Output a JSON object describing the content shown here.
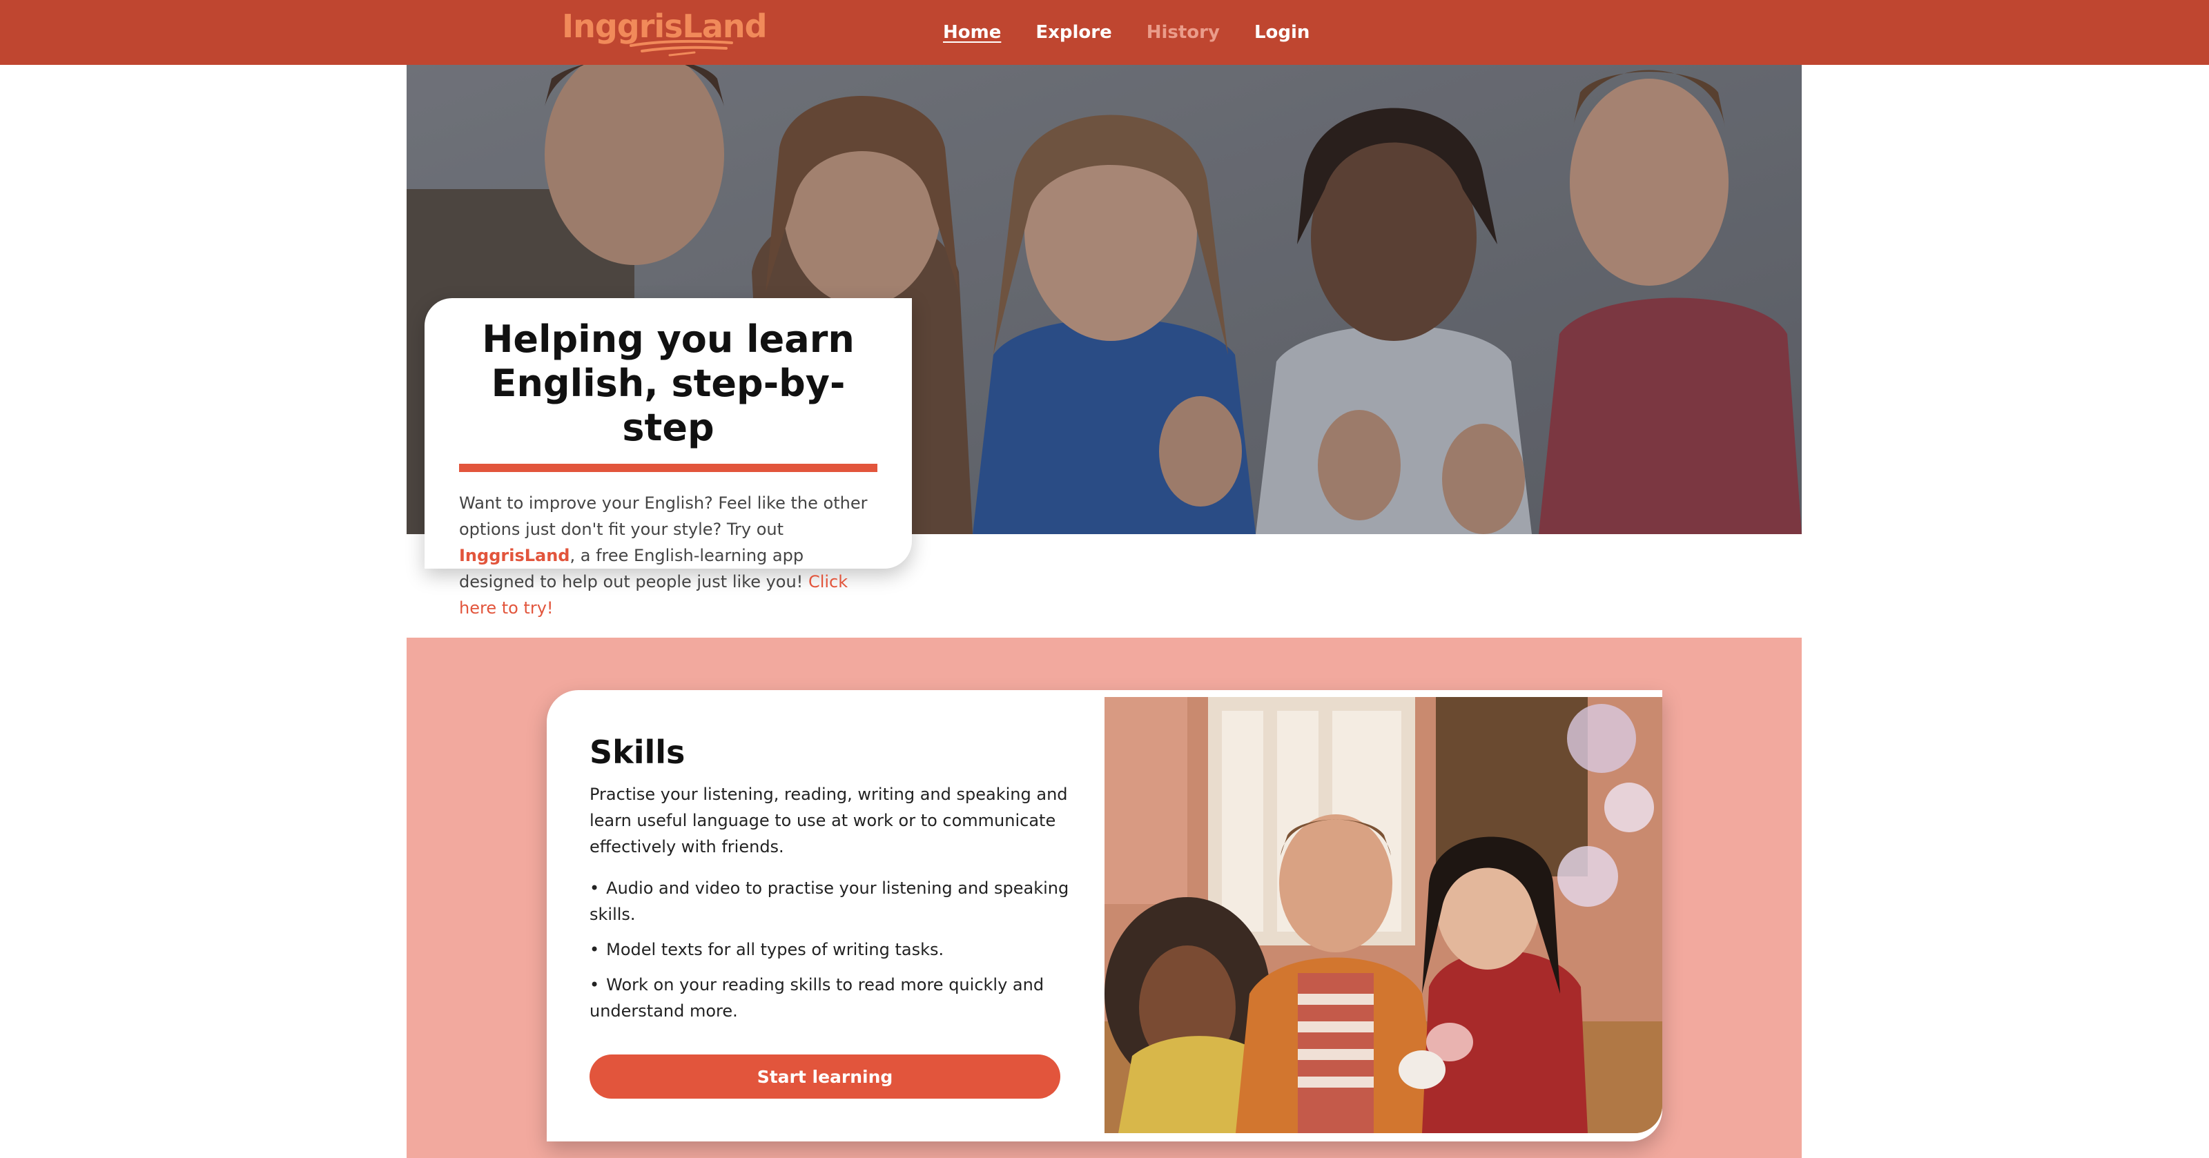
{
  "header": {
    "logo_text": "InggrisLand",
    "nav": [
      {
        "label": "Home"
      },
      {
        "label": "Explore"
      },
      {
        "label": "History"
      },
      {
        "label": "Login"
      }
    ]
  },
  "hero": {
    "title": "Helping you learn English, step-by-step",
    "text_before": "Want to improve your English? Feel like the other options just don't fit your style? Try out ",
    "brand": "InggrisLand",
    "text_after": ", a free English-learning app designed to help out people just like you! ",
    "cta_link": "Click here to try!"
  },
  "skills": {
    "title": "Skills",
    "intro": "Practise your listening, reading, writing and speaking and learn useful language to use at work or to communicate effectively with friends.",
    "bullet_char": "•",
    "items": [
      "Audio and video to practise your listening and speaking skills.",
      "Model texts for all types of writing tasks.",
      "Work on your reading skills to read more quickly and understand more."
    ],
    "button_label": "Start learning"
  },
  "colors": {
    "header_bg": "#bf4630",
    "accent": "#e2553c",
    "section_bg": "#f2a99e",
    "nav_muted": "#ea9c8a"
  }
}
